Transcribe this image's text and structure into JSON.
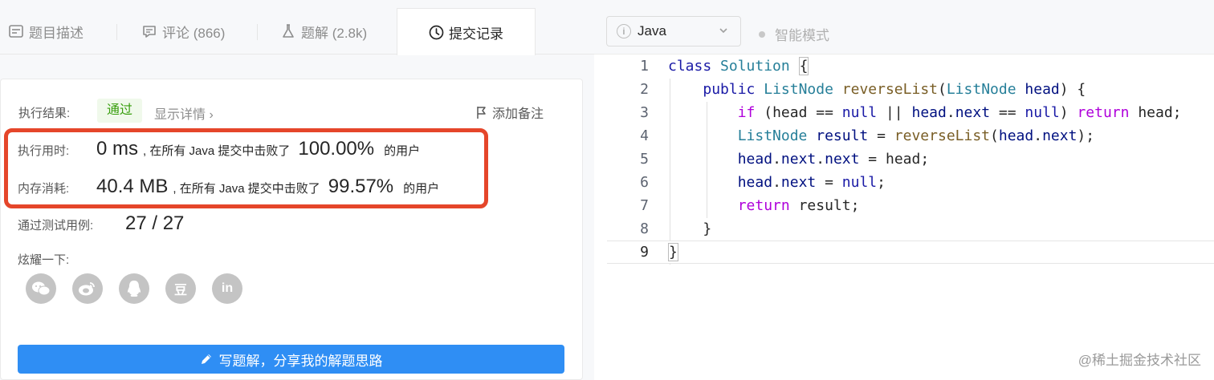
{
  "tabs": [
    {
      "label": "题目描述",
      "icon": "description-icon"
    },
    {
      "label": "评论 (866)",
      "icon": "comment-icon"
    },
    {
      "label": "题解 (2.8k)",
      "icon": "flask-icon"
    },
    {
      "label": "提交记录",
      "icon": "clock-icon",
      "active": true
    }
  ],
  "result": {
    "label": "执行结果:",
    "status": "通过",
    "detail_link": "显示详情 ›",
    "note_link": "添加备注"
  },
  "runtime": {
    "label": "执行用时:",
    "value": "0 ms",
    "beat_text": ", 在所有 Java 提交中击败了",
    "percent": "100.00%",
    "suffix": "的用户"
  },
  "memory": {
    "label": "内存消耗:",
    "value": "40.4 MB",
    "beat_text": ", 在所有 Java 提交中击败了",
    "percent": "99.57%",
    "suffix": "的用户"
  },
  "testcases": {
    "label": "通过测试用例:",
    "value": "27 / 27"
  },
  "share": {
    "label": "炫耀一下:",
    "icons": [
      "wechat-icon",
      "weibo-icon",
      "qq-icon",
      "douban-icon",
      "linkedin-icon"
    ],
    "douban_glyph": "豆",
    "linkedin_glyph": "in"
  },
  "solution_button": "写题解，分享我的解题思路",
  "editor": {
    "language": "Java",
    "smart_mode": "智能模式",
    "line_numbers": [
      "1",
      "2",
      "3",
      "4",
      "5",
      "6",
      "7",
      "8",
      "9"
    ]
  },
  "watermark": "@稀土掘金技术社区",
  "colors": {
    "highlight_border": "#e5462a",
    "button_blue": "#2f8ef4",
    "pass_green": "#389e0d"
  }
}
